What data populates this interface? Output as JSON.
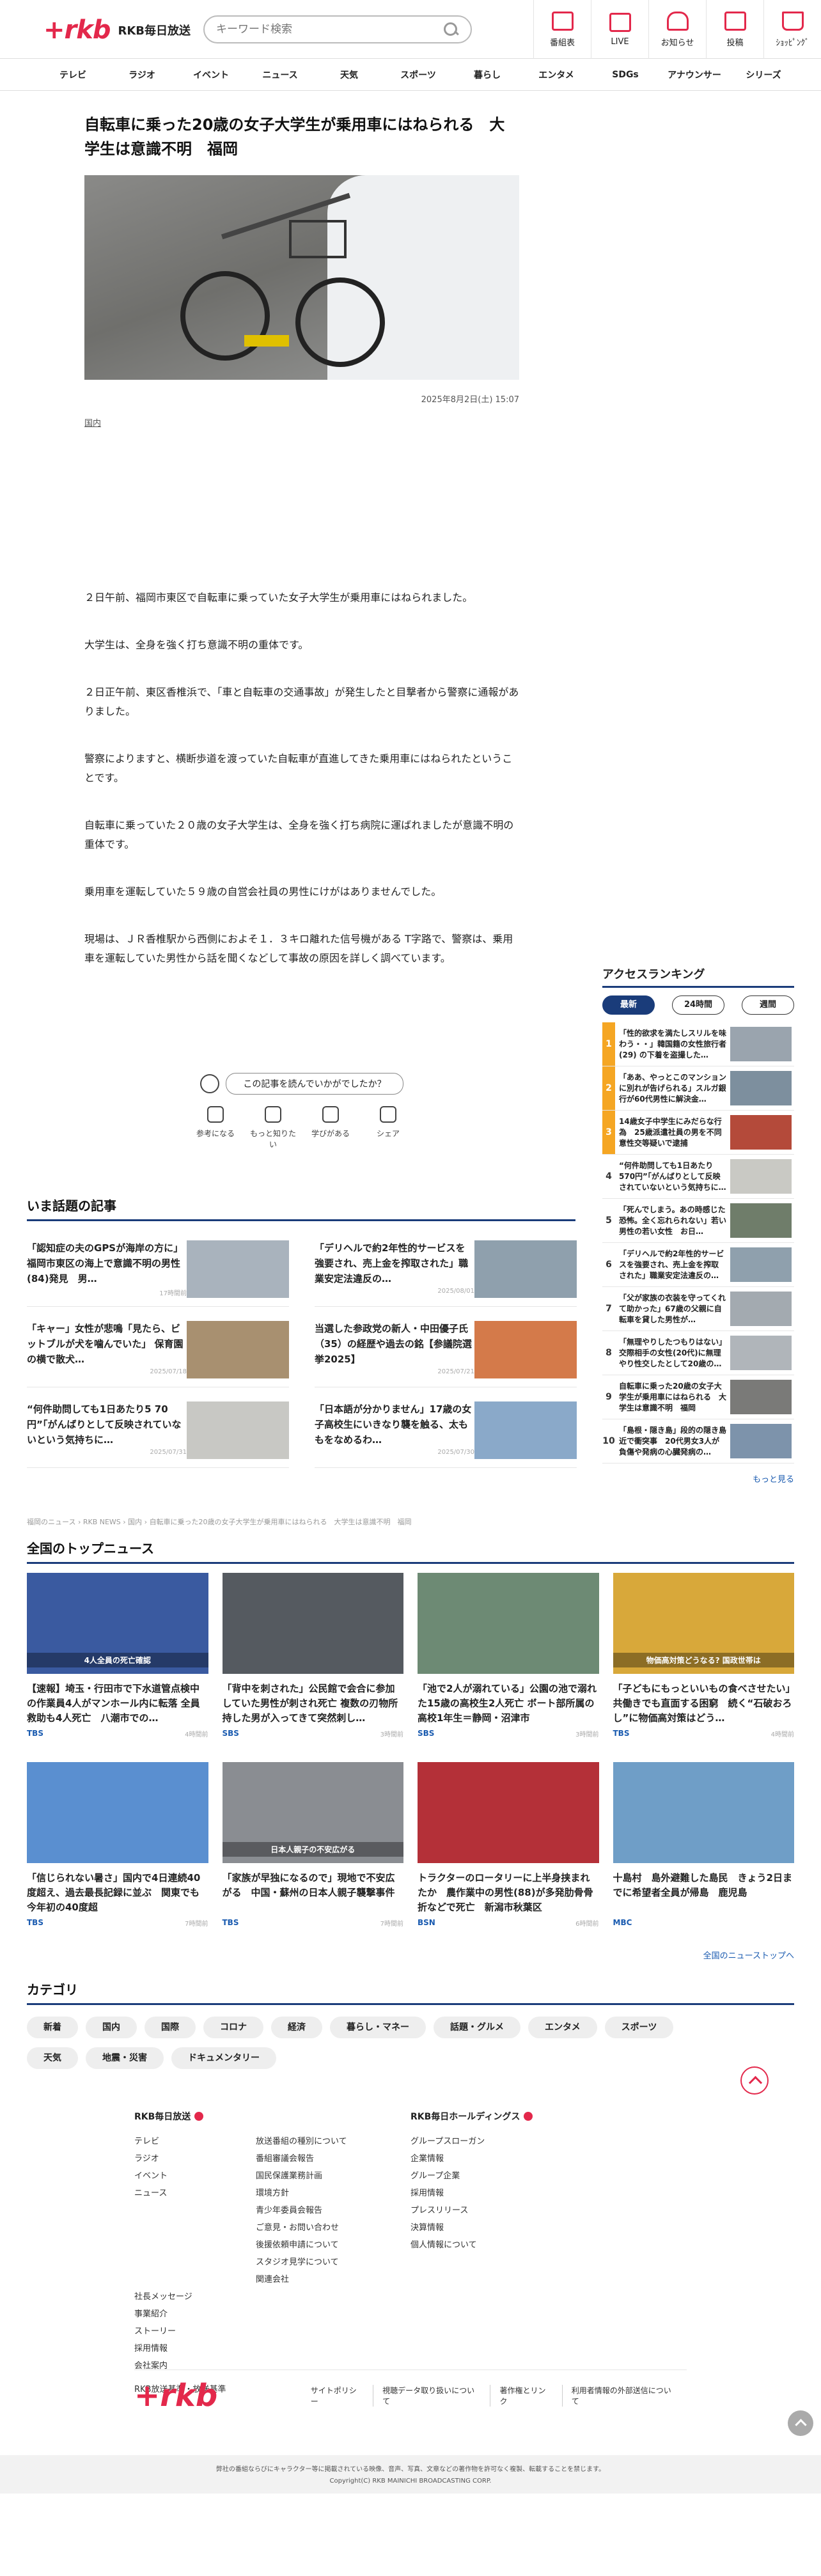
{
  "header": {
    "logo_mark": "+rkb",
    "logo_text": "RKB毎日放送",
    "search_placeholder": "キーワード検索",
    "icons": [
      {
        "label": "番組表",
        "icon": "calendar-icon"
      },
      {
        "label": "LIVE",
        "icon": "live-tv-icon"
      },
      {
        "label": "お知らせ",
        "icon": "bell-icon"
      },
      {
        "label": "投稿",
        "icon": "post-icon"
      },
      {
        "label": "ｼｮｯﾋﾟﾝｸﾞ",
        "icon": "cart-icon"
      }
    ]
  },
  "nav": [
    "テレビ",
    "ラジオ",
    "イベント",
    "ニュース",
    "天気",
    "スポーツ",
    "暮らし",
    "エンタメ",
    "SDGs",
    "アナウンサー",
    "シリーズ"
  ],
  "article": {
    "title": "自転車に乗った20歳の女子大学生が乗用車にはねられる　大学生は意識不明　福岡",
    "date": "2025年8月2日(土) 15:07",
    "category": "国内",
    "paragraphs": [
      "２日午前、福岡市東区で自転車に乗っていた女子大学生が乗用車にはねられました。",
      "大学生は、全身を強く打ち意識不明の重体です。",
      "２日正午前、東区香椎浜で、「車と自転車の交通事故」が発生したと目撃者から警察に通報がありました。",
      "警察によりますと、横断歩道を渡っていた自転車が直進してきた乗用車にはねられたということです。",
      "自転車に乗っていた２０歳の女子大学生は、全身を強く打ち病院に運ばれましたが意識不明の重体です。",
      "乗用車を運転していた５９歳の自営会社員の男性にけがはありませんでした。",
      "現場は、ＪＲ香椎駅から西側におよそ１．３キロ離れた信号機がある T字路で、警察は、乗用車を運転していた男性から話を聞くなどして事故の原因を詳しく調べています。"
    ],
    "ask": "この記事を読んでいかがでしたか？",
    "reactions": [
      "参考になる",
      "もっと知りたい",
      "学びがある",
      "シェア"
    ]
  },
  "wadai": {
    "title": "いま話題の記事",
    "items": [
      {
        "title": "「認知症の夫のGPSが海岸の方に」福岡市東区の海上で意識不明の男性(84)発見　男…",
        "date": "17時間前",
        "color": "#a9b3bd"
      },
      {
        "title": "「デリヘルで約2年性的サービスを強要され、売上金を搾取された」職業安定法違反の…",
        "date": "2025/08/01",
        "color": "#8fa0ad"
      },
      {
        "title": "「キャー」女性が悲鳴「見たら、ビットブルが犬を噛んでいた」 保育園の横で散犬…",
        "date": "2025/07/18",
        "color": "#a89070"
      },
      {
        "title": "当選した参政党の新人・中田優子氏（35）の経歴や過去の銘【参議院選挙2025】",
        "date": "2025/07/21",
        "color": "#d47a4a"
      },
      {
        "title": "“何件助問しても1日あたり5 70円”「がんばりとして反映されていないという気持ちに…",
        "date": "2025/07/31",
        "color": "#c8c8c4"
      },
      {
        "title": "「日本語が分かりません」17歳の女子高校生にいきなり襲を触る、太ももをなめるわ…",
        "date": "2025/07/30",
        "color": "#8aa9c9"
      }
    ]
  },
  "breadcrumb": "福岡のニュース › RKB NEWS › 国内 › 自転車に乗った20歳の女子大学生が乗用車にはねられる　大学生は意識不明　福岡",
  "ranking": {
    "title": "アクセスランキング",
    "tabs": [
      "最新",
      "24時間",
      "週間"
    ],
    "items": [
      {
        "num": "1",
        "title": "「性的欲求を満たしスリルを味わう・・」韓国籍の女性旅行者(29) の下着を盗撮した…",
        "color": "#9aa4ae"
      },
      {
        "num": "2",
        "title": "「ああ、やっとこのマンションに別れが告げられる」スルガ銀行が60代男性に解決金…",
        "color": "#7d8f9e"
      },
      {
        "num": "3",
        "title": "14歳女子中学生にみだらな行為　25歳派遣社員の男を不同意性交等疑いで逮捕",
        "color": "#b44a3a"
      },
      {
        "num": "4",
        "title": "“何件助問しても1日あたり570円”「がんばりとして反映されていないという気持ちに…",
        "color": "#c9c9c4"
      },
      {
        "num": "5",
        "title": "「死んでしまう。あの時感じた恐怖。全く忘れられない」若い男性の若い女性　お日…",
        "color": "#6f7d6a"
      },
      {
        "num": "6",
        "title": "「デリヘルで約2年性的サービスを強要され、売上金を搾取された」職業安定法違反の…",
        "color": "#8fa0ad"
      },
      {
        "num": "7",
        "title": "「父が家族の衣装を守ってくれて助かった」67歳の父親に自転車を貸した男性が…",
        "color": "#a3aab0"
      },
      {
        "num": "8",
        "title": "「無理やりしたつもりはない」交際相手の女性(20代)に無理やり性交したとして20歳の…",
        "color": "#b0b5ba"
      },
      {
        "num": "9",
        "title": "自転車に乗った20歳の女子大学生が乗用車にはねられる　大学生は意識不明　福岡",
        "color": "#7a7a78"
      },
      {
        "num": "10",
        "title": "「島根・隠き島」段的の隠き島近で衝突事　20代男女3人が負傷や発病の心臓発病の…",
        "color": "#7d93ab"
      }
    ],
    "more": "もっと見る"
  },
  "national": {
    "title": "全国のトップニュース",
    "items": [
      {
        "title": "【速報】埼玉・行田市で下水道管点検中の作業員4人がマンホール内に転落 全員救助も4人死亡　八潮市での…",
        "src": "TBS",
        "date": "4時間前",
        "color": "#3a5aa0",
        "tag": "4人全員の死亡確認"
      },
      {
        "title": "「背中を刺された」公民館で会合に参加していた男性が刺され死亡 複数の刃物所持した男が入ってきて突然刺し…",
        "src": "SBS",
        "date": "3時間前",
        "color": "#555a60",
        "tag": ""
      },
      {
        "title": "「池で2人が溺れている」公園の池で溺れた15歳の高校生2人死亡 ボート部所属の高校1年生＝静岡・沼津市",
        "src": "SBS",
        "date": "3時間前",
        "color": "#6d8a74",
        "tag": ""
      },
      {
        "title": "「子どもにもっといいもの食べさせたい」共働きでも直面する困窮　続く“石破おろし”に物価高対策はどう…",
        "src": "TBS",
        "date": "4時間前",
        "color": "#d8a83a",
        "tag": "物価高対策どうなる? 国政世帯は"
      },
      {
        "title": "「信じられない暑さ」国内で4日連続40度超え、過去最長記録に並ぶ　関東でも今年初の40度超",
        "src": "TBS",
        "date": "7時間前",
        "color": "#5a8fd0",
        "tag": ""
      },
      {
        "title": "「家族が早独になるので」現地で不安広がる　中国・蘇州の日本人親子襲撃事件",
        "src": "TBS",
        "date": "7時間前",
        "color": "#8a8d92",
        "tag": "日本人親子の不安広がる"
      },
      {
        "title": "トラクターのロータリーに上半身挟まれたか　農作業中の男性(88)が多発肋骨骨折などで死亡　新潟市秋葉区",
        "src": "BSN",
        "date": "6時間前",
        "color": "#b43038",
        "tag": ""
      },
      {
        "title": "十島村　島外避難した島民　きょう2日までに希望者全員が帰島　鹿児島",
        "src": "MBC",
        "date": "",
        "color": "#6f9ec7",
        "tag": ""
      }
    ],
    "more": "全国のニューストップへ"
  },
  "category": {
    "title": "カテゴリ",
    "chips": [
      "新着",
      "国内",
      "国際",
      "コロナ",
      "経済",
      "暮らし・マネー",
      "話題・グルメ",
      "エンタメ",
      "スポーツ",
      "天気",
      "地震・災害",
      "ドキュメンタリー"
    ]
  },
  "footer": {
    "col1_title": "RKB毎日放送",
    "col1_list1": [
      "テレビ",
      "ラジオ",
      "イベント",
      "ニュース"
    ],
    "col1_list1b": [
      "社長メッセージ",
      "事業紹介",
      "ストーリー",
      "採用情報",
      "会社案内"
    ],
    "col1_extra": "RKB放送基準・放送基準",
    "col1_list2": [
      "放送番組の種別について",
      "番組審議会報告",
      "国民保護業務計画",
      "環境方針",
      "青少年委員会報告",
      "ご意見・お問い合わせ",
      "後援依頼申請について",
      "スタジオ見学について",
      "関連会社"
    ],
    "col2_title": "RKB毎日ホールディングス",
    "col2_list": [
      "グループスローガン",
      "企業情報",
      "グループ企業",
      "採用情報",
      "プレスリリース",
      "決算情報",
      "個人情報について"
    ],
    "bar_logo": "+rkb",
    "bar_links": [
      "サイトポリシー",
      "視聴データ取り扱いについて",
      "著作権とリンク",
      "利用者情報の外部送信について"
    ],
    "copy1": "弊社の番組ならびにキャラクター等に掲載されている映像、音声、写真、文章などの著作物を許可なく複製、転載することを禁じます。",
    "copy2": "Copyright(C) RKB MAINICHI BROADCASTING CORP."
  }
}
